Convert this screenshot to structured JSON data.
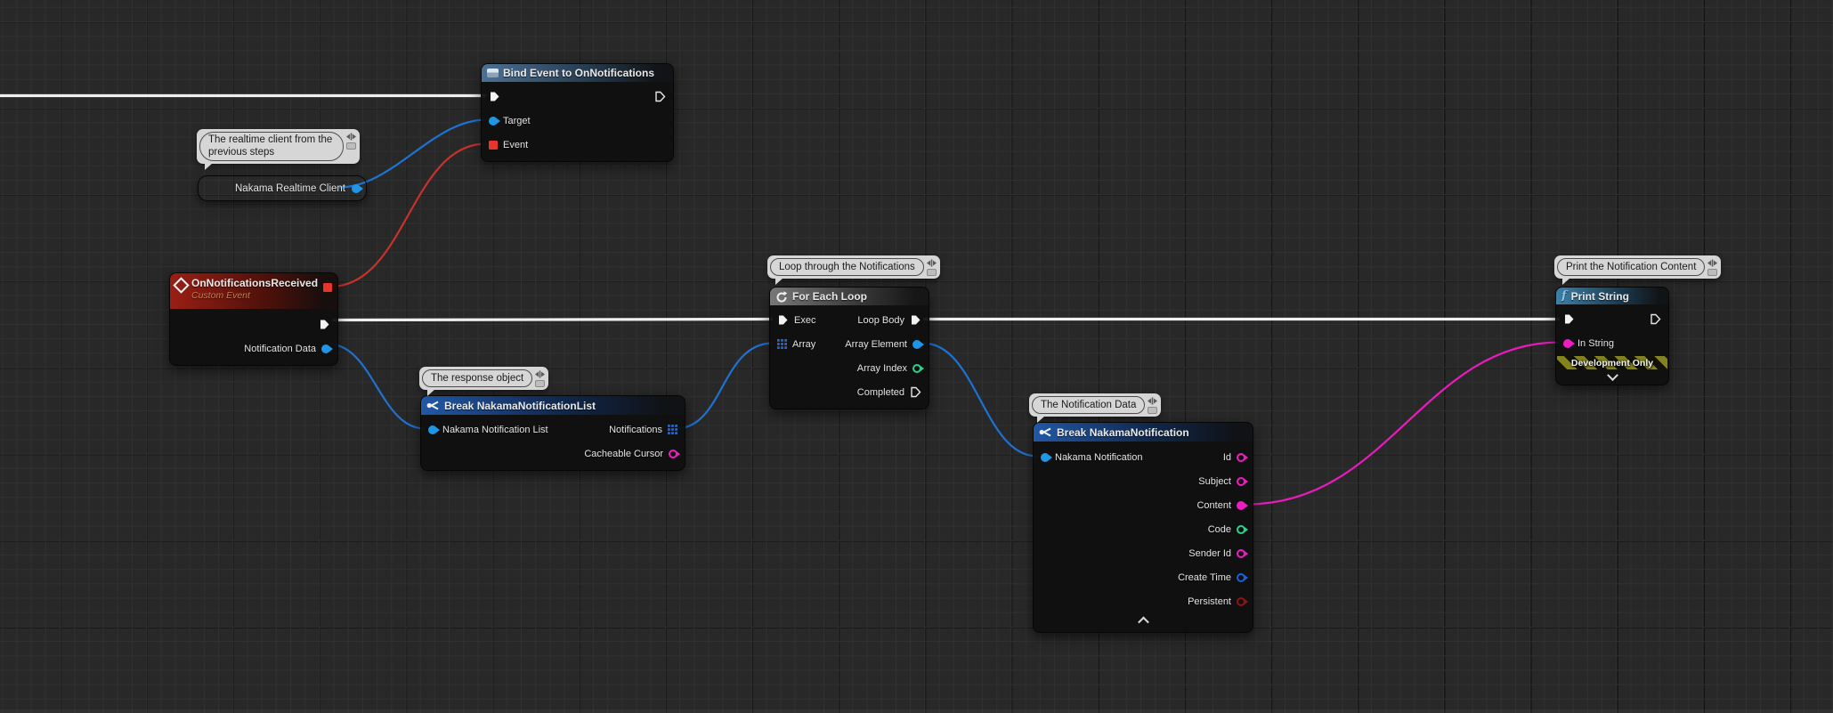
{
  "colors": {
    "exec_wire": "#efefef",
    "object_wire": "#1d72d2",
    "delegate_wire": "#c8322a",
    "string_wire": "#e81bbd",
    "object_pin": "#1f96e8",
    "string_pin": "#ee1cc3",
    "int_pin": "#29d489",
    "struct_pin": "#1b62d8",
    "bool_pin": "#8f1512",
    "event_header": "#9a1f14",
    "function_header": "#2258a6"
  },
  "comments": {
    "realtime_client": "The realtime client from the previous steps",
    "response_object": "The response object",
    "loop_notifications": "Loop through the Notifications",
    "notification_data": "The Notification Data",
    "print_content": "Print the Notification Content"
  },
  "nodes": {
    "bind_event": {
      "title": "Bind Event to OnNotifications",
      "pins": {
        "target": "Target",
        "event": "Event"
      }
    },
    "nakama_client": {
      "label": "Nakama Realtime Client"
    },
    "on_notifications_received": {
      "title": "OnNotificationsReceived",
      "subtitle": "Custom Event",
      "pins": {
        "notification_data": "Notification Data"
      }
    },
    "break_notification_list": {
      "title": "Break NakamaNotificationList",
      "pins": {
        "input": "Nakama Notification List",
        "notifications": "Notifications",
        "cacheable_cursor": "Cacheable Cursor"
      }
    },
    "for_each_loop": {
      "title": "For Each Loop",
      "pins": {
        "exec": "Exec",
        "array": "Array",
        "loop_body": "Loop Body",
        "array_element": "Array Element",
        "array_index": "Array Index",
        "completed": "Completed"
      }
    },
    "break_notification": {
      "title": "Break NakamaNotification",
      "pins": {
        "input": "Nakama Notification",
        "id": "Id",
        "subject": "Subject",
        "content": "Content",
        "code": "Code",
        "sender_id": "Sender Id",
        "create_time": "Create Time",
        "persistent": "Persistent"
      }
    },
    "print_string": {
      "title": "Print String",
      "pins": {
        "in_string": "In String"
      },
      "dev_only_label": "Development Only"
    }
  }
}
